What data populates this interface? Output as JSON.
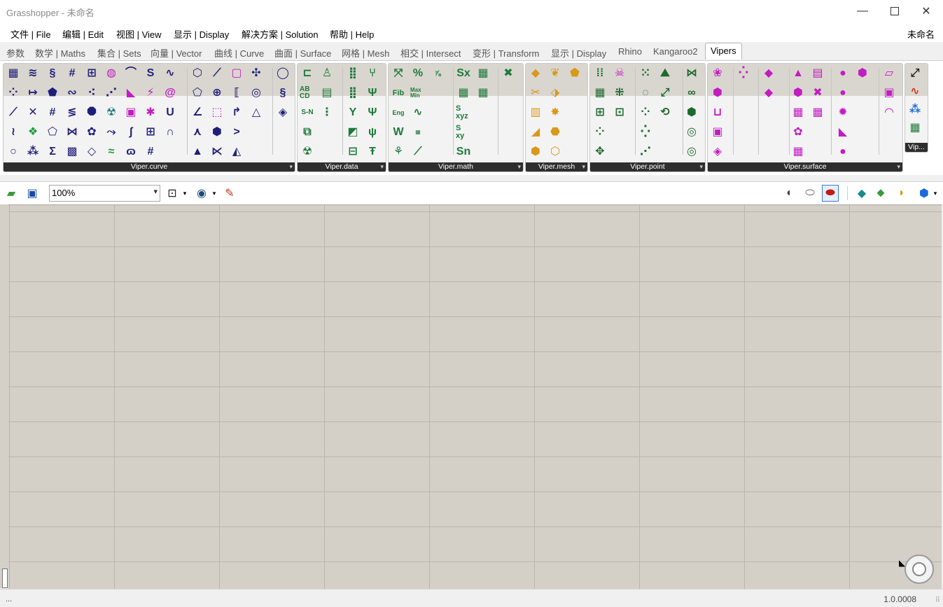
{
  "window": {
    "title": "Grasshopper - 未命名",
    "minimize_icon": "minimize-icon",
    "maximize_icon": "maximize-icon",
    "close_icon": "close-icon"
  },
  "menu": {
    "items": [
      "文件 | File",
      "编辑 | Edit",
      "视图 | View",
      "显示 | Display",
      "解决方案 | Solution",
      "帮助 | Help"
    ],
    "document_name": "未命名"
  },
  "tabs": [
    "参数",
    "数学 | Maths",
    "集合 | Sets",
    "向量 | Vector",
    "曲线 | Curve",
    "曲面 | Surface",
    "网格 | Mesh",
    "相交 | Intersect",
    "变形 | Transform",
    "显示 | Display",
    "Rhino",
    "Kangaroo2",
    "Vipers"
  ],
  "active_tab": "Vipers",
  "ribbon": {
    "panels": [
      {
        "name": "Viper.curve",
        "color": "#1f1f7a"
      },
      {
        "name": "Viper.data",
        "color": "#1e7a3a"
      },
      {
        "name": "Viper.math",
        "color": "#1e7a3a"
      },
      {
        "name": "Viper.mesh",
        "color": "#d9981a"
      },
      {
        "name": "Viper.point",
        "color": "#1e6a2e"
      },
      {
        "name": "Viper.surface",
        "color": "#c21cc2"
      },
      {
        "name": "Vip..."
      }
    ],
    "math_labels": {
      "percent": "%",
      "sx": "Sx",
      "fib": "Fib",
      "maxmin": "Max Min",
      "sn_label": "S-N",
      "abcd": "AB CD",
      "sxyz": "S xyz",
      "sxy": "S xy",
      "sn": "Sn",
      "eng": "Eng"
    }
  },
  "toolbar": {
    "zoom": "100%",
    "open_icon": "open-folder-icon",
    "save_icon": "save-icon",
    "zoom_extents_icon": "zoom-extents-icon",
    "preview_icon": "eye-icon",
    "sketch_icon": "pen-icon"
  },
  "status": {
    "left_text": "...",
    "version": "1.0.0008"
  }
}
